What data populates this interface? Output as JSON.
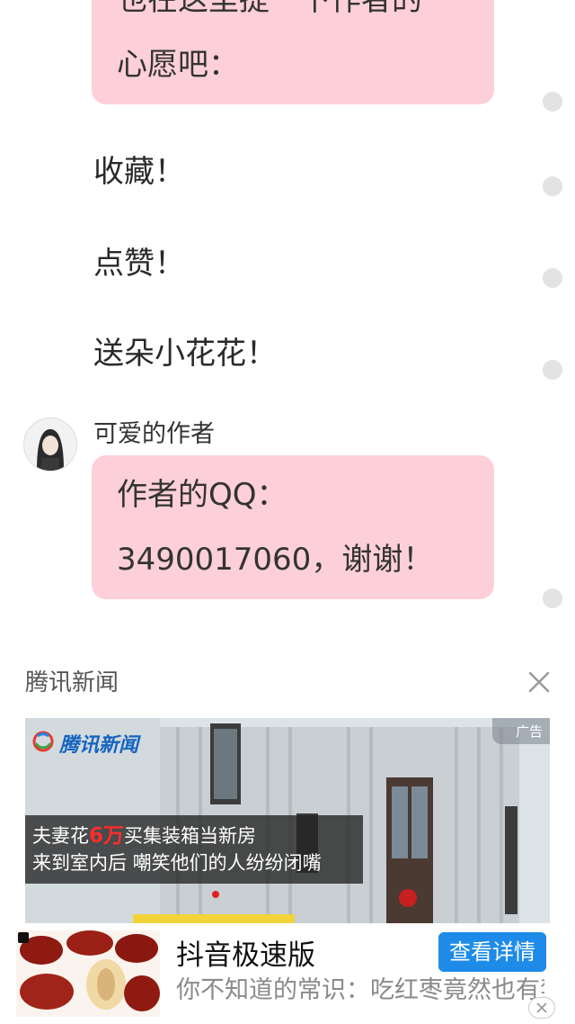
{
  "chat": {
    "first_bubble_lines": [
      "也在这里提一下作者的",
      "心愿吧："
    ],
    "messages": [
      "收藏！",
      "点赞！",
      "送朵小花花！"
    ],
    "author": {
      "name": "可爱的作者",
      "bubble_lines": [
        "作者的QQ：",
        "3490017060，谢谢！"
      ]
    }
  },
  "ad": {
    "source": "腾讯新闻",
    "badge": "广告",
    "logo_text": "腾讯新闻",
    "caption_line1_prefix": "夫妻花",
    "caption_line1_highlight": "6万",
    "caption_line1_suffix": "买集装箱当新房",
    "caption_line2": "来到室内后 嘲笑他们的人纷纷闭嘴",
    "app_name": "抖音极速版",
    "detail_button": "查看详情",
    "description": "你不知道的常识：吃红枣竟然也有禁忌"
  },
  "colors": {
    "bubble": "#fdd0d9",
    "button": "#1e8be8",
    "highlight": "#ff2d2d"
  }
}
